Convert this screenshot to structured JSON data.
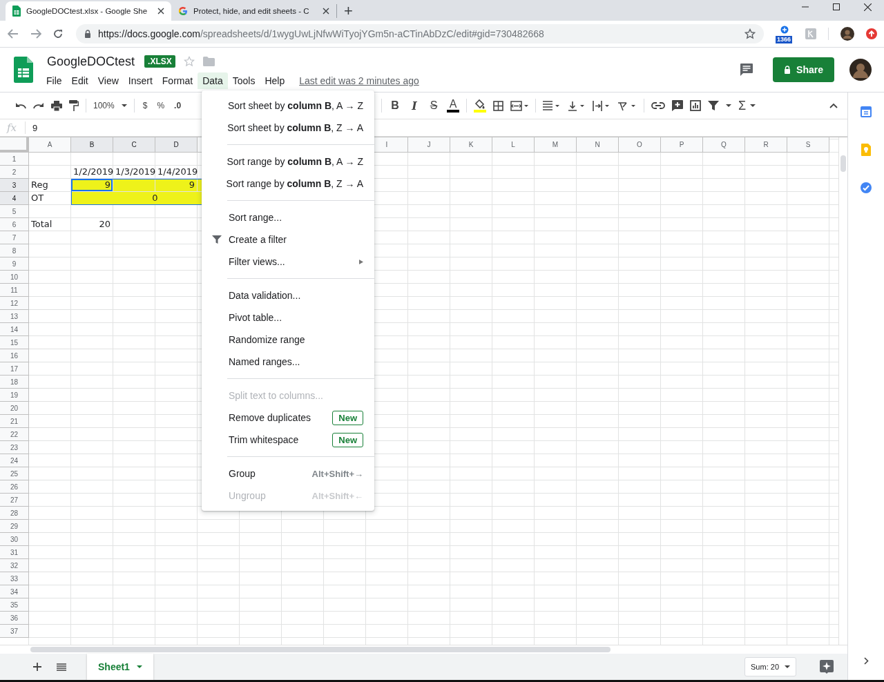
{
  "browser": {
    "tabs": [
      {
        "title": "GoogleDOCtest.xlsx - Google She",
        "selected": true
      },
      {
        "title": "Protect, hide, and edit sheets - C",
        "selected": false
      }
    ],
    "new_tab": "+",
    "url_host": "https://docs.google.com",
    "url_path": "/spreadsheets/d/1wygUwLjNfwWiTyojYGm5n-aCTinAbDzC/edit#gid=730482668",
    "extension_badge": "1366"
  },
  "document": {
    "title": "GoogleDOCtest",
    "badge": ".XLSX",
    "last_edit": "Last edit was 2 minutes ago",
    "share": "Share",
    "menus": [
      {
        "label": "File",
        "selected": false
      },
      {
        "label": "Edit",
        "selected": false
      },
      {
        "label": "View",
        "selected": false
      },
      {
        "label": "Insert",
        "selected": false
      },
      {
        "label": "Format",
        "selected": false
      },
      {
        "label": "Data",
        "selected": true
      },
      {
        "label": "Tools",
        "selected": false
      },
      {
        "label": "Help",
        "selected": false
      }
    ]
  },
  "toolbar": {
    "zoom": "100%",
    "currency": "$",
    "percent": "%",
    "decimal": ".0",
    "format_buttons": [
      "B",
      "I",
      "S",
      "A"
    ],
    "functions": "Σ"
  },
  "formula_bar": {
    "label": "fx",
    "value": "9"
  },
  "grid": {
    "columns": [
      {
        "label": "A",
        "selected": false
      },
      {
        "label": "B",
        "selected": true
      },
      {
        "label": "C",
        "selected": true
      },
      {
        "label": "D",
        "selected": true
      },
      null,
      null,
      null,
      null,
      {
        "label": "I",
        "selected": false
      },
      {
        "label": "J",
        "selected": false
      },
      {
        "label": "K",
        "selected": false
      },
      {
        "label": "L",
        "selected": false
      },
      {
        "label": "M",
        "selected": false
      },
      {
        "label": "N",
        "selected": false
      },
      {
        "label": "O",
        "selected": false
      },
      {
        "label": "P",
        "selected": false
      },
      {
        "label": "Q",
        "selected": false
      },
      {
        "label": "R",
        "selected": false
      },
      {
        "label": "S",
        "selected": false
      }
    ],
    "rows": [
      {
        "number": "1",
        "selected": false
      },
      {
        "number": "2",
        "selected": false,
        "cells": [
          null,
          {
            "text": "1/2/2019",
            "kind": "number"
          },
          {
            "text": "1/3/2019",
            "kind": "number"
          },
          {
            "text": "1/4/2019",
            "kind": "number"
          }
        ]
      },
      {
        "number": "3",
        "selected": true,
        "cells": [
          {
            "text": "Reg",
            "kind": "text"
          },
          {
            "text": "9",
            "kind": "number",
            "highlight": true,
            "in_range": true,
            "selected": true
          },
          {
            "kind": "number",
            "highlight": true,
            "in_range": true,
            "selected": false
          },
          {
            "text": "9",
            "kind": "number",
            "highlight": true,
            "in_range": true,
            "selected": false
          },
          {
            "kind": "number",
            "highlight": true,
            "in_range": true,
            "selected": false
          }
        ]
      },
      {
        "number": "4",
        "selected": true,
        "cells": [
          {
            "text": "OT",
            "kind": "text"
          },
          {
            "text": "0",
            "kind": "merged",
            "highlight": true,
            "in_range": true,
            "selected": false
          }
        ]
      },
      {
        "number": "5",
        "selected": false
      },
      {
        "number": "6",
        "selected": false,
        "cells": [
          {
            "text": "Total",
            "kind": "text"
          },
          {
            "text": "20",
            "kind": "number"
          }
        ]
      },
      {
        "number": "7",
        "selected": false
      },
      {
        "number": "8",
        "selected": false
      },
      {
        "number": "9",
        "selected": false
      },
      {
        "number": "10",
        "selected": false
      },
      {
        "number": "11",
        "selected": false
      },
      {
        "number": "12",
        "selected": false
      },
      {
        "number": "13",
        "selected": false
      },
      {
        "number": "14",
        "selected": false
      },
      {
        "number": "15",
        "selected": false
      },
      {
        "number": "16",
        "selected": false
      },
      {
        "number": "17",
        "selected": false
      },
      {
        "number": "18",
        "selected": false
      },
      {
        "number": "19",
        "selected": false
      },
      {
        "number": "20",
        "selected": false
      },
      {
        "number": "21",
        "selected": false
      },
      {
        "number": "22",
        "selected": false
      },
      {
        "number": "23",
        "selected": false
      },
      {
        "number": "24",
        "selected": false
      },
      {
        "number": "25",
        "selected": false
      },
      {
        "number": "26",
        "selected": false
      },
      {
        "number": "27",
        "selected": false
      },
      {
        "number": "28",
        "selected": false
      },
      {
        "number": "29",
        "selected": false
      },
      {
        "number": "30",
        "selected": false
      },
      {
        "number": "31",
        "selected": false
      },
      {
        "number": "32",
        "selected": false
      },
      {
        "number": "33",
        "selected": false
      },
      {
        "number": "34",
        "selected": false
      },
      {
        "number": "35",
        "selected": false
      },
      {
        "number": "36",
        "selected": false
      },
      {
        "number": "37",
        "selected": false
      }
    ]
  },
  "data_menu": {
    "items": [
      {
        "kind": "item",
        "label": "Sort sheet by **column B**, A → Z",
        "disabled": false
      },
      {
        "kind": "item",
        "label": "Sort sheet by **column B**, Z → A",
        "disabled": false
      },
      {
        "kind": "separator"
      },
      {
        "kind": "item",
        "label": "Sort range by **column B**, A → Z",
        "disabled": false
      },
      {
        "kind": "item",
        "label": "Sort range by **column B**, Z → A",
        "disabled": false
      },
      {
        "kind": "separator"
      },
      {
        "kind": "item",
        "label": "Sort range...",
        "disabled": false
      },
      {
        "kind": "icon_item",
        "label": "Create a filter",
        "disabled": false
      },
      {
        "kind": "item",
        "label": "Filter views...",
        "disabled": false,
        "submenu": true
      },
      {
        "kind": "separator"
      },
      {
        "kind": "item",
        "label": "Data validation...",
        "disabled": false
      },
      {
        "kind": "item",
        "label": "Pivot table...",
        "disabled": false
      },
      {
        "kind": "item",
        "label": "Randomize range",
        "disabled": false
      },
      {
        "kind": "item",
        "label": "Named ranges...",
        "disabled": false
      },
      {
        "kind": "separator"
      },
      {
        "kind": "item",
        "label": "Split text to columns...",
        "disabled": true
      },
      {
        "kind": "item",
        "label": "Remove duplicates",
        "disabled": false,
        "badge": "New"
      },
      {
        "kind": "item",
        "label": "Trim whitespace",
        "disabled": false,
        "badge": "New"
      },
      {
        "kind": "separator"
      },
      {
        "kind": "item",
        "label": "Group",
        "disabled": false,
        "shortcut": "Alt+Shift+→"
      },
      {
        "kind": "item",
        "label": "Ungroup",
        "disabled": true,
        "shortcut": "Alt+Shift+←"
      }
    ]
  },
  "sheet_tabs": [
    {
      "label": "Sheet1",
      "selected": true
    }
  ],
  "status": {
    "sum": "Sum: 20"
  }
}
